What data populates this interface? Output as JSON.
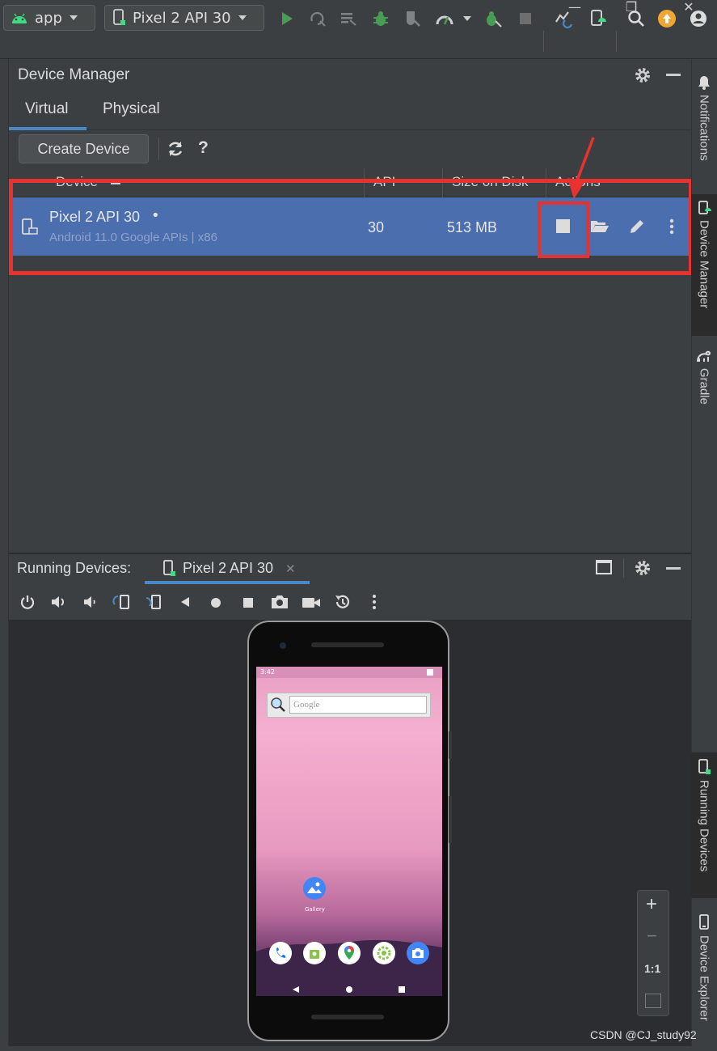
{
  "window": {
    "minimize": "—",
    "restore": "❐",
    "close": "✕"
  },
  "toolbar": {
    "run_config": "app",
    "device_selector": "Pixel 2 API 30",
    "icons": [
      "run-icon",
      "apply-changes-icon",
      "apply-code-changes-icon",
      "debug-icon",
      "attach-debugger-icon",
      "profile-icon",
      "stop-icon",
      "sync-icon",
      "device-manager-icon",
      "search-icon",
      "update-icon",
      "account-icon"
    ]
  },
  "device_manager": {
    "title": "Device Manager",
    "tabs": [
      "Virtual",
      "Physical"
    ],
    "create_button": "Create Device",
    "help": "?",
    "columns": [
      "Device",
      "API",
      "Size on Disk",
      "Actions"
    ],
    "rows": [
      {
        "name": "Pixel 2 API 30",
        "online_dot": "•",
        "subtitle": "Android 11.0 Google APIs | x86",
        "api": "30",
        "size": "513 MB"
      }
    ]
  },
  "right_sidebar": [
    "Notifications",
    "Device Manager",
    "Gradle",
    "Running Devices",
    "Device Explorer"
  ],
  "running_devices": {
    "label": "Running Devices:",
    "tab": "Pixel 2 API 30",
    "tab_close": "✕",
    "zoom": {
      "plus": "+",
      "minus": "−",
      "one_to_one": "1:1"
    }
  },
  "phone": {
    "time": "3:42",
    "search_placeholder": "Google",
    "app_label": "Gallery"
  },
  "colors": {
    "accent": "#4a88c7",
    "selection": "#4b6eaf",
    "annotation": "#e8322f",
    "run_green": "#499c54"
  },
  "watermark": "CSDN @CJ_study92"
}
